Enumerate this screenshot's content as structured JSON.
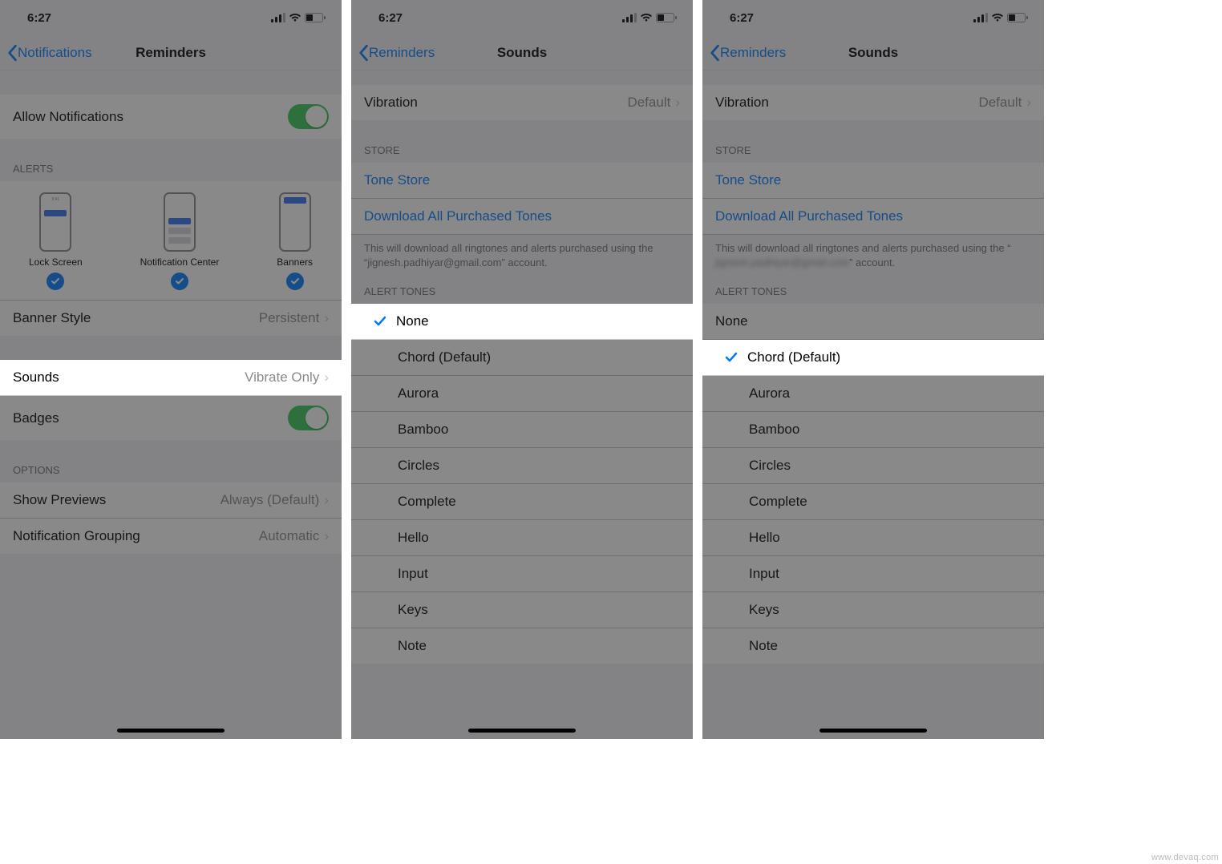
{
  "watermark": "www.devaq.com",
  "status": {
    "time": "6:27"
  },
  "screen1": {
    "back": "Notifications",
    "title": "Reminders",
    "allow": "Allow Notifications",
    "alerts_header": "ALERTS",
    "alert_options": {
      "lock": "Lock Screen",
      "nc": "Notification Center",
      "banners": "Banners",
      "mock_time": "9:41"
    },
    "banner_style": {
      "label": "Banner Style",
      "value": "Persistent"
    },
    "sounds": {
      "label": "Sounds",
      "value": "Vibrate Only"
    },
    "badges": "Badges",
    "options_header": "OPTIONS",
    "show_previews": {
      "label": "Show Previews",
      "value": "Always (Default)"
    },
    "grouping": {
      "label": "Notification Grouping",
      "value": "Automatic"
    }
  },
  "screen2": {
    "back": "Reminders",
    "title": "Sounds",
    "vibration": {
      "label": "Vibration",
      "value": "Default"
    },
    "store_header": "STORE",
    "tone_store": "Tone Store",
    "download_all": "Download All Purchased Tones",
    "footer_pre": "This will download all ringtones and alerts purchased using the “",
    "footer_email": "jignesh.padhiyar@gmail.com",
    "footer_post": "” account.",
    "alert_tones_header": "ALERT TONES",
    "selected": "None",
    "tones": [
      "None",
      "Chord (Default)",
      "Aurora",
      "Bamboo",
      "Circles",
      "Complete",
      "Hello",
      "Input",
      "Keys",
      "Note"
    ]
  },
  "screen3": {
    "back": "Reminders",
    "title": "Sounds",
    "vibration": {
      "label": "Vibration",
      "value": "Default"
    },
    "store_header": "STORE",
    "tone_store": "Tone Store",
    "download_all": "Download All Purchased Tones",
    "footer_pre": "This will download all ringtones and alerts purchased using the “",
    "footer_email": "jignesh.padhiyar@gmail.com",
    "footer_post": "” account.",
    "alert_tones_header": "ALERT TONES",
    "selected": "Chord (Default)",
    "tones": [
      "None",
      "Chord (Default)",
      "Aurora",
      "Bamboo",
      "Circles",
      "Complete",
      "Hello",
      "Input",
      "Keys",
      "Note"
    ]
  }
}
